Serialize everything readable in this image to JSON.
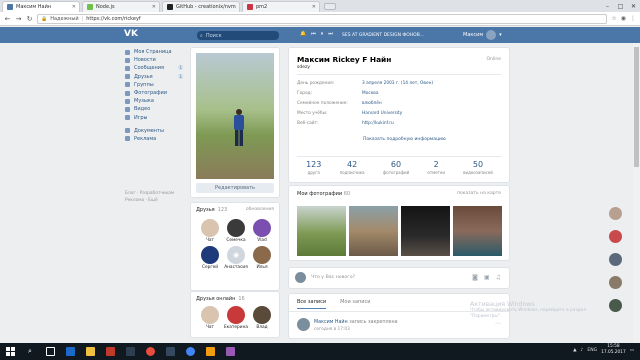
{
  "browser": {
    "tabs": [
      {
        "title": "Максим Найн",
        "color": "#4a76a8"
      },
      {
        "title": "Node.js",
        "color": "#6cc24a"
      },
      {
        "title": "GitHub - creationix/nvm",
        "color": "#222222"
      },
      {
        "title": "pm2",
        "color": "#cc3344"
      }
    ],
    "security": "Надежный",
    "url": "https://vk.com/rickeyf"
  },
  "header": {
    "logo": "VK",
    "search_placeholder": "Поиск",
    "now_playing": "SES AT GRADIENT DESIGN ФОНОВ...",
    "user_name": "Максим"
  },
  "menu": {
    "items": [
      {
        "label": "Моя Страница",
        "count": ""
      },
      {
        "label": "Новости",
        "count": ""
      },
      {
        "label": "Сообщения",
        "count": "1"
      },
      {
        "label": "Друзья",
        "count": "1"
      },
      {
        "label": "Группы",
        "count": ""
      },
      {
        "label": "Фотографии",
        "count": ""
      },
      {
        "label": "Музыка",
        "count": ""
      },
      {
        "label": "Видео",
        "count": ""
      },
      {
        "label": "Игры",
        "count": ""
      }
    ],
    "items2": [
      {
        "label": "Документы"
      },
      {
        "label": "Реклама"
      }
    ],
    "footer1": "Блог · Разработчикам",
    "footer2": "Реклама · Ещё"
  },
  "profile": {
    "edit_label": "Редактировать",
    "name": "Максим Rickey F Найн",
    "status": "sdezy",
    "online": "Online",
    "info": [
      {
        "label": "День рождения:",
        "value": "3 апреля 2003 г. (14 лет, Овен)"
      },
      {
        "label": "Город:",
        "value": "Москва"
      },
      {
        "label": "Семейное положение:",
        "value": "влюблён"
      },
      {
        "label": "Место учёбы:",
        "value": "Harvard University"
      },
      {
        "label": "Веб-сайт:",
        "value": "http://kukinf.ru"
      }
    ],
    "more_label": "Показать подробную информацию",
    "stats": [
      {
        "num": "123",
        "label": "друга"
      },
      {
        "num": "42",
        "label": "подписчика"
      },
      {
        "num": "60",
        "label": "фотографий"
      },
      {
        "num": "2",
        "label": "отметки"
      },
      {
        "num": "50",
        "label": "видеозаписей"
      }
    ]
  },
  "friends": {
    "title": "Друзья",
    "count": "123",
    "updates": "обновления",
    "list": [
      {
        "name": "Чат",
        "color": "#d9c4b0"
      },
      {
        "name": "Семечка",
        "color": "#3a3a3a"
      },
      {
        "name": "Vlad",
        "color": "#7a4fb0"
      },
      {
        "name": "Сергей",
        "color": "#1e3a7a"
      },
      {
        "name": "Анастасия",
        "color": "#d0d6dd"
      },
      {
        "name": "Илья",
        "color": "#8a6a4a"
      }
    ]
  },
  "online": {
    "title": "Друзья онлайн",
    "count": "16",
    "list": [
      {
        "name": "Чат",
        "color": "#d9c4b0"
      },
      {
        "name": "Екатерина",
        "color": "#c83a3a"
      },
      {
        "name": "Влад",
        "color": "#5a4a3a"
      }
    ]
  },
  "photos": {
    "title": "Мои фотографии",
    "count": "60",
    "map_label": "показать на карте",
    "thumbs": [
      {
        "color": "#7e9a54"
      },
      {
        "color": "#a38a6a"
      },
      {
        "color": "#1e1e1e"
      },
      {
        "color": "#7a5a4a"
      }
    ]
  },
  "post": {
    "placeholder": "Что у Вас нового?"
  },
  "wall": {
    "tab_all": "Все записи",
    "tab_mine": "Мои записи",
    "author": "Максим Найн",
    "action": "запись закреплена",
    "date": "сегодня в 17:03"
  },
  "activation": {
    "title": "Активация Windows",
    "line1": "Чтобы активировать Windows, перейдите в раздел",
    "line2": "\"Параметры\"."
  },
  "taskbar": {
    "lang": "ENG",
    "time": "15:58",
    "date": "17.05.2017"
  }
}
